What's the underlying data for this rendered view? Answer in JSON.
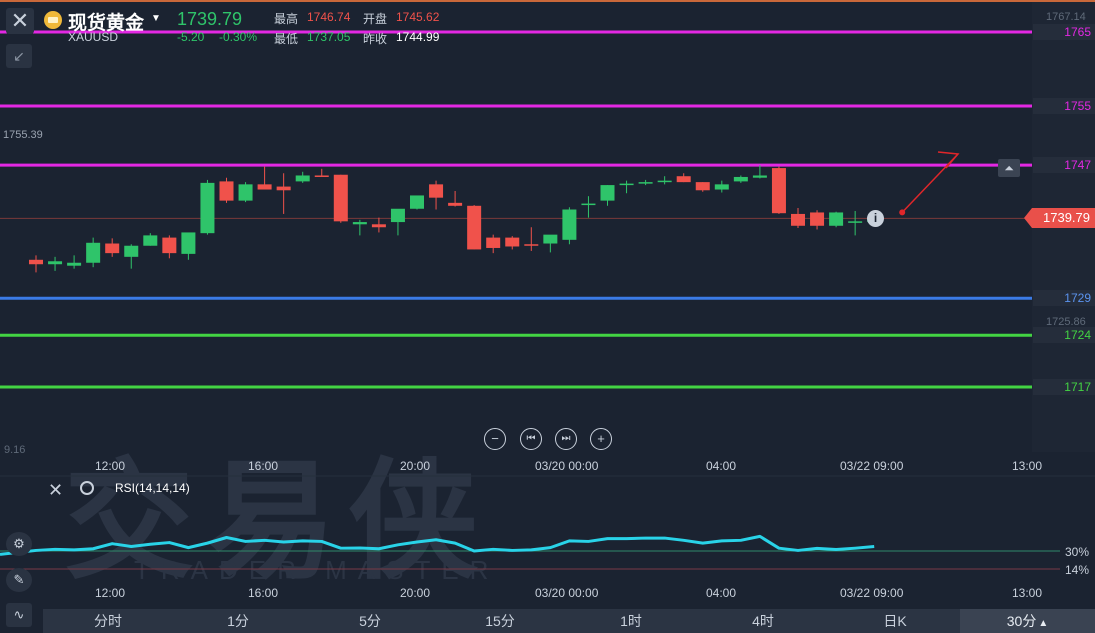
{
  "header": {
    "title": "现货黄金",
    "price": "1739.79",
    "symbol": "XAUUSD",
    "change": "-5.20",
    "change_pct": "-0.30%",
    "high_label": "最高",
    "high_value": "1746.74",
    "open_label": "开盘",
    "open_value": "1745.62",
    "low_label": "最低",
    "low_value": "1737.05",
    "prev_label": "昨收",
    "prev_value": "1744.99"
  },
  "price_levels": [
    {
      "label": "1765",
      "color": "#e328e3"
    },
    {
      "label": "1755",
      "color": "#e328e3"
    },
    {
      "label": "1747",
      "color": "#e328e3"
    },
    {
      "label": "1729",
      "color": "#3b7be6"
    },
    {
      "label": "1724",
      "color": "#43d443"
    },
    {
      "label": "1717",
      "color": "#43d443"
    }
  ],
  "current_price_tag": "1739.79",
  "gray_labels": {
    "top_right": "1767.14",
    "left_marker": "1755.39",
    "mid_right": "1725.86",
    "left_lower": "9.16"
  },
  "time_axis": [
    "12:00",
    "16:00",
    "20:00",
    "03/20 00:00",
    "04:00",
    "03/22 09:00",
    "13:00"
  ],
  "rsi": {
    "label": "RSI(14,14,14)",
    "level_30": "30%",
    "level_14": "14%"
  },
  "watermark": {
    "cn": "交易侠",
    "en": "TRADER MASTER"
  },
  "tabs": [
    "分时",
    "1分",
    "5分",
    "15分",
    "1时",
    "4时",
    "日K",
    "30分"
  ],
  "active_tab_caret": "▲",
  "icons": [
    "close-icon",
    "shrink-icon",
    "gold-coin-icon",
    "caret-down-icon",
    "zoom-out-icon",
    "step-back-icon",
    "step-forward-icon",
    "zoom-in-icon",
    "alert-bell-icon",
    "info-icon",
    "settings-icon",
    "pencil-icon",
    "indicator-icon"
  ],
  "colors": {
    "up": "#2fc46a",
    "down": "#f0524b",
    "rsi": "#29d3e8"
  },
  "chart_data": {
    "type": "candlestick",
    "symbol": "XAUUSD",
    "interval": "30分",
    "candles": [
      {
        "o": 1734.2,
        "h": 1734.8,
        "l": 1732.5,
        "c": 1733.6
      },
      {
        "o": 1733.6,
        "h": 1734.6,
        "l": 1732.7,
        "c": 1734.0
      },
      {
        "o": 1733.4,
        "h": 1734.8,
        "l": 1733.0,
        "c": 1733.8
      },
      {
        "o": 1733.8,
        "h": 1737.2,
        "l": 1733.2,
        "c": 1736.5
      },
      {
        "o": 1736.4,
        "h": 1737.1,
        "l": 1734.6,
        "c": 1735.1
      },
      {
        "o": 1734.6,
        "h": 1736.3,
        "l": 1733.0,
        "c": 1736.1
      },
      {
        "o": 1736.1,
        "h": 1737.8,
        "l": 1736.1,
        "c": 1737.5
      },
      {
        "o": 1737.2,
        "h": 1737.5,
        "l": 1734.4,
        "c": 1735.1
      },
      {
        "o": 1735.0,
        "h": 1737.7,
        "l": 1734.2,
        "c": 1737.9
      },
      {
        "o": 1737.8,
        "h": 1745.0,
        "l": 1737.6,
        "c": 1744.6
      },
      {
        "o": 1744.8,
        "h": 1745.3,
        "l": 1741.9,
        "c": 1742.2
      },
      {
        "o": 1742.2,
        "h": 1744.7,
        "l": 1742.0,
        "c": 1744.4
      },
      {
        "o": 1744.4,
        "h": 1746.8,
        "l": 1743.8,
        "c": 1743.7
      },
      {
        "o": 1744.1,
        "h": 1745.9,
        "l": 1740.4,
        "c": 1743.6
      },
      {
        "o": 1744.8,
        "h": 1746.1,
        "l": 1744.6,
        "c": 1745.6
      },
      {
        "o": 1745.6,
        "h": 1746.5,
        "l": 1745.6,
        "c": 1745.5
      },
      {
        "o": 1745.7,
        "h": 1745.7,
        "l": 1739.2,
        "c": 1739.4
      },
      {
        "o": 1739.0,
        "h": 1739.6,
        "l": 1737.5,
        "c": 1739.3
      },
      {
        "o": 1739.0,
        "h": 1739.9,
        "l": 1737.9,
        "c": 1738.6
      },
      {
        "o": 1739.3,
        "h": 1740.9,
        "l": 1737.5,
        "c": 1741.1
      },
      {
        "o": 1741.1,
        "h": 1742.8,
        "l": 1741.0,
        "c": 1742.9
      },
      {
        "o": 1744.4,
        "h": 1744.9,
        "l": 1741.0,
        "c": 1742.6
      },
      {
        "o": 1741.9,
        "h": 1743.5,
        "l": 1741.4,
        "c": 1741.5
      },
      {
        "o": 1741.5,
        "h": 1741.6,
        "l": 1735.6,
        "c": 1735.6
      },
      {
        "o": 1737.2,
        "h": 1737.6,
        "l": 1735.1,
        "c": 1735.8
      },
      {
        "o": 1737.2,
        "h": 1737.4,
        "l": 1735.6,
        "c": 1736.0
      },
      {
        "o": 1736.3,
        "h": 1738.6,
        "l": 1735.4,
        "c": 1736.1
      },
      {
        "o": 1736.4,
        "h": 1737.5,
        "l": 1735.2,
        "c": 1737.6
      },
      {
        "o": 1736.9,
        "h": 1741.3,
        "l": 1736.3,
        "c": 1741.0
      },
      {
        "o": 1741.6,
        "h": 1742.8,
        "l": 1739.9,
        "c": 1741.8
      },
      {
        "o": 1742.2,
        "h": 1744.3,
        "l": 1741.5,
        "c": 1744.3
      },
      {
        "o": 1744.4,
        "h": 1744.9,
        "l": 1743.2,
        "c": 1744.5
      },
      {
        "o": 1744.5,
        "h": 1745.0,
        "l": 1744.3,
        "c": 1744.7
      },
      {
        "o": 1744.7,
        "h": 1745.5,
        "l": 1744.4,
        "c": 1744.9
      },
      {
        "o": 1745.5,
        "h": 1745.9,
        "l": 1744.7,
        "c": 1744.7
      },
      {
        "o": 1744.7,
        "h": 1744.7,
        "l": 1743.4,
        "c": 1743.6
      },
      {
        "o": 1743.7,
        "h": 1744.9,
        "l": 1743.3,
        "c": 1744.4
      },
      {
        "o": 1744.8,
        "h": 1745.6,
        "l": 1744.6,
        "c": 1745.4
      },
      {
        "o": 1745.3,
        "h": 1747.0,
        "l": 1745.2,
        "c": 1745.6
      },
      {
        "o": 1746.6,
        "h": 1746.8,
        "l": 1740.4,
        "c": 1740.5
      },
      {
        "o": 1740.4,
        "h": 1741.2,
        "l": 1738.5,
        "c": 1738.8
      },
      {
        "o": 1740.6,
        "h": 1740.9,
        "l": 1738.3,
        "c": 1738.8
      },
      {
        "o": 1738.8,
        "h": 1740.7,
        "l": 1738.6,
        "c": 1740.6
      },
      {
        "o": 1739.4,
        "h": 1740.8,
        "l": 1737.5,
        "c": 1739.4
      },
      {
        "o": 1739.3,
        "h": 1740.5,
        "l": 1739.1,
        "c": 1739.8
      }
    ],
    "rsi_values": [
      30.5,
      31.5,
      31.0,
      32.0,
      36.5,
      34.0,
      36.0,
      37.5,
      33.0,
      37.0,
      42.0,
      38.5,
      39.5,
      38.0,
      39.0,
      38.5,
      32.5,
      32.7,
      32.0,
      35.5,
      38.0,
      40.0,
      37.0,
      30.0,
      31.5,
      30.5,
      31.0,
      33.0,
      39.0,
      38.5,
      41.0,
      41.0,
      41.5,
      41.5,
      39.5,
      37.0,
      39.0,
      39.5,
      43.0,
      32.5,
      30.5,
      32.3,
      31.3,
      32.5,
      34.0
    ],
    "y_range": [
      1715,
      1768
    ],
    "rsi_range": [
      10,
      55
    ],
    "projection_target": 1748.5
  }
}
